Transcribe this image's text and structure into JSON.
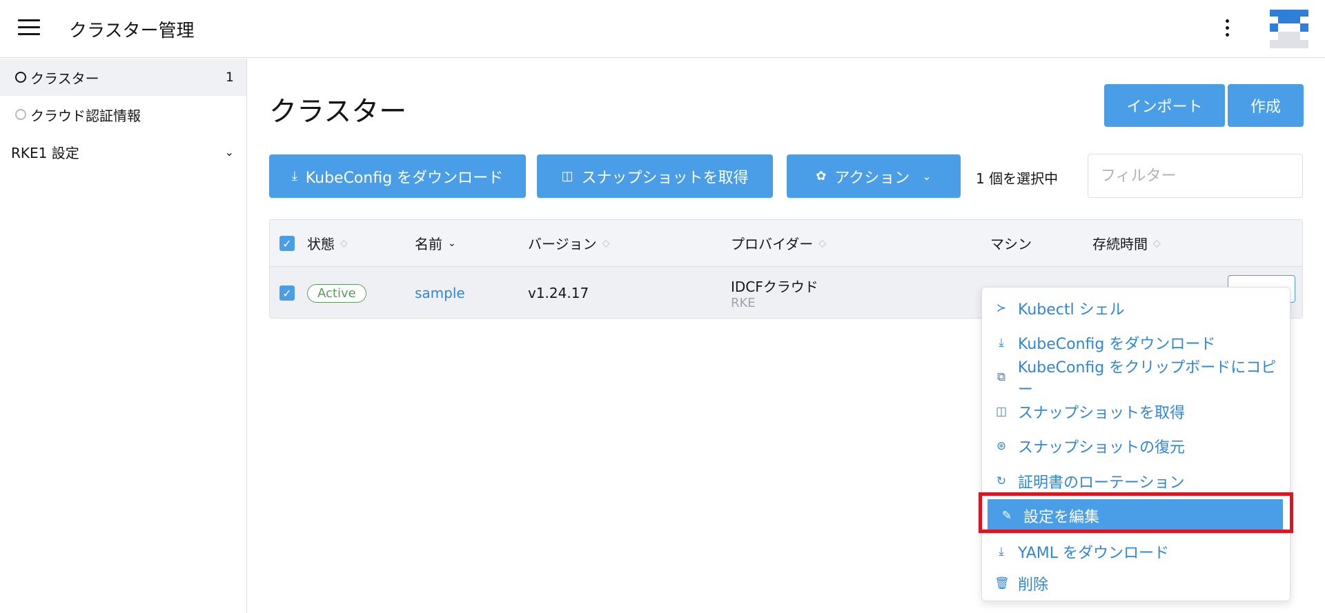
{
  "header": {
    "title": "クラスター管理"
  },
  "sidebar": {
    "items": [
      {
        "label": "クラスター",
        "count": "1"
      },
      {
        "label": "クラウド認証情報"
      },
      {
        "label": "RKE1 設定"
      }
    ]
  },
  "main": {
    "title": "クラスター",
    "import_label": "インポート",
    "create_label": "作成",
    "download_kubeconfig_label": "KubeConfig をダウンロード",
    "snapshot_label": "スナップショットを取得",
    "action_label": "アクション",
    "selected_text": "1 個を選択中",
    "filter_placeholder": "フィルター"
  },
  "table": {
    "headers": {
      "state": "状態",
      "name": "名前",
      "version": "バージョン",
      "provider": "プロバイダー",
      "machines": "マシン",
      "age": "存続時間"
    },
    "row": {
      "state": "Active",
      "name": "sample",
      "version": "v1.24.17",
      "provider": "IDCFクラウド",
      "provider_sub": "RKE"
    }
  },
  "menu": {
    "items": [
      {
        "label": "Kubectl シェル",
        "icon": "terminal-icon"
      },
      {
        "label": "KubeConfig をダウンロード",
        "icon": "download-icon"
      },
      {
        "label": "KubeConfig をクリップボードにコピー",
        "icon": "copy-icon"
      },
      {
        "label": "スナップショットを取得",
        "icon": "camera-icon"
      },
      {
        "label": "スナップショットの復元",
        "icon": "restore-icon"
      },
      {
        "label": "証明書のローテーション",
        "icon": "rotate-icon"
      },
      {
        "label": "設定を編集",
        "icon": "pencil-icon"
      },
      {
        "label": "YAML をダウンロード",
        "icon": "download-icon"
      },
      {
        "label": "削除",
        "icon": "trash-icon"
      }
    ]
  },
  "colors": {
    "accent": "#4a9ee8",
    "link": "#2f86d6",
    "active": "#5b9a5e",
    "highlight_outline": "#e0141e"
  }
}
